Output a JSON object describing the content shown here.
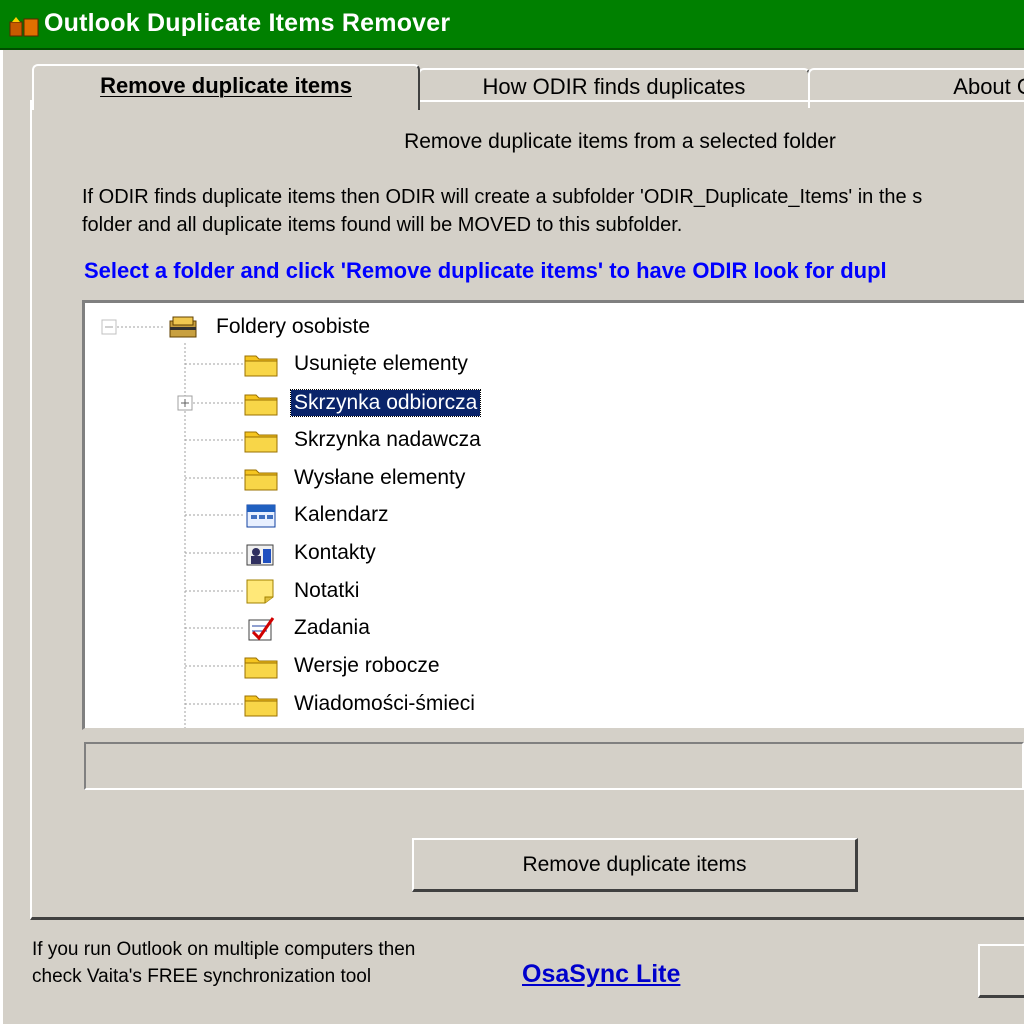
{
  "window": {
    "title": "Outlook Duplicate Items Remover"
  },
  "tabs": [
    {
      "label": "Remove duplicate items"
    },
    {
      "label": "How ODIR finds duplicates"
    },
    {
      "label": "About O"
    }
  ],
  "panel": {
    "header": "Remove duplicate items from a selected folder",
    "description_line1": "If ODIR finds duplicate items then ODIR will create a subfolder 'ODIR_Duplicate_Items' in the s",
    "description_line2": "folder and all duplicate items found will be MOVED to this subfolder.",
    "instruction": "Select a folder and click 'Remove duplicate items' to have ODIR look for dupl"
  },
  "tree": {
    "root": {
      "label": "Foldery osobiste",
      "icon": "personal-folders-icon"
    },
    "children": [
      {
        "label": "Usunięte elementy",
        "icon": "folder-icon"
      },
      {
        "label": "Skrzynka odbiorcza",
        "icon": "folder-icon",
        "selected": true,
        "expandable": true
      },
      {
        "label": "Skrzynka nadawcza",
        "icon": "folder-icon"
      },
      {
        "label": "Wysłane elementy",
        "icon": "folder-icon"
      },
      {
        "label": "Kalendarz",
        "icon": "calendar-icon"
      },
      {
        "label": "Kontakty",
        "icon": "contacts-icon"
      },
      {
        "label": "Notatki",
        "icon": "notes-icon"
      },
      {
        "label": "Zadania",
        "icon": "tasks-icon"
      },
      {
        "label": "Wersje robocze",
        "icon": "folder-icon"
      },
      {
        "label": "Wiadomości-śmieci",
        "icon": "folder-icon"
      }
    ]
  },
  "buttons": {
    "remove": "Remove duplicate items"
  },
  "footer": {
    "line1": "If you run Outlook on multiple computers then",
    "line2": "check Vaita's FREE synchronization tool",
    "link": "OsaSync Lite"
  },
  "colors": {
    "titlebar": "#008000",
    "instruction": "#0000ff",
    "selection": "#0a246a",
    "link": "#0000cc"
  }
}
